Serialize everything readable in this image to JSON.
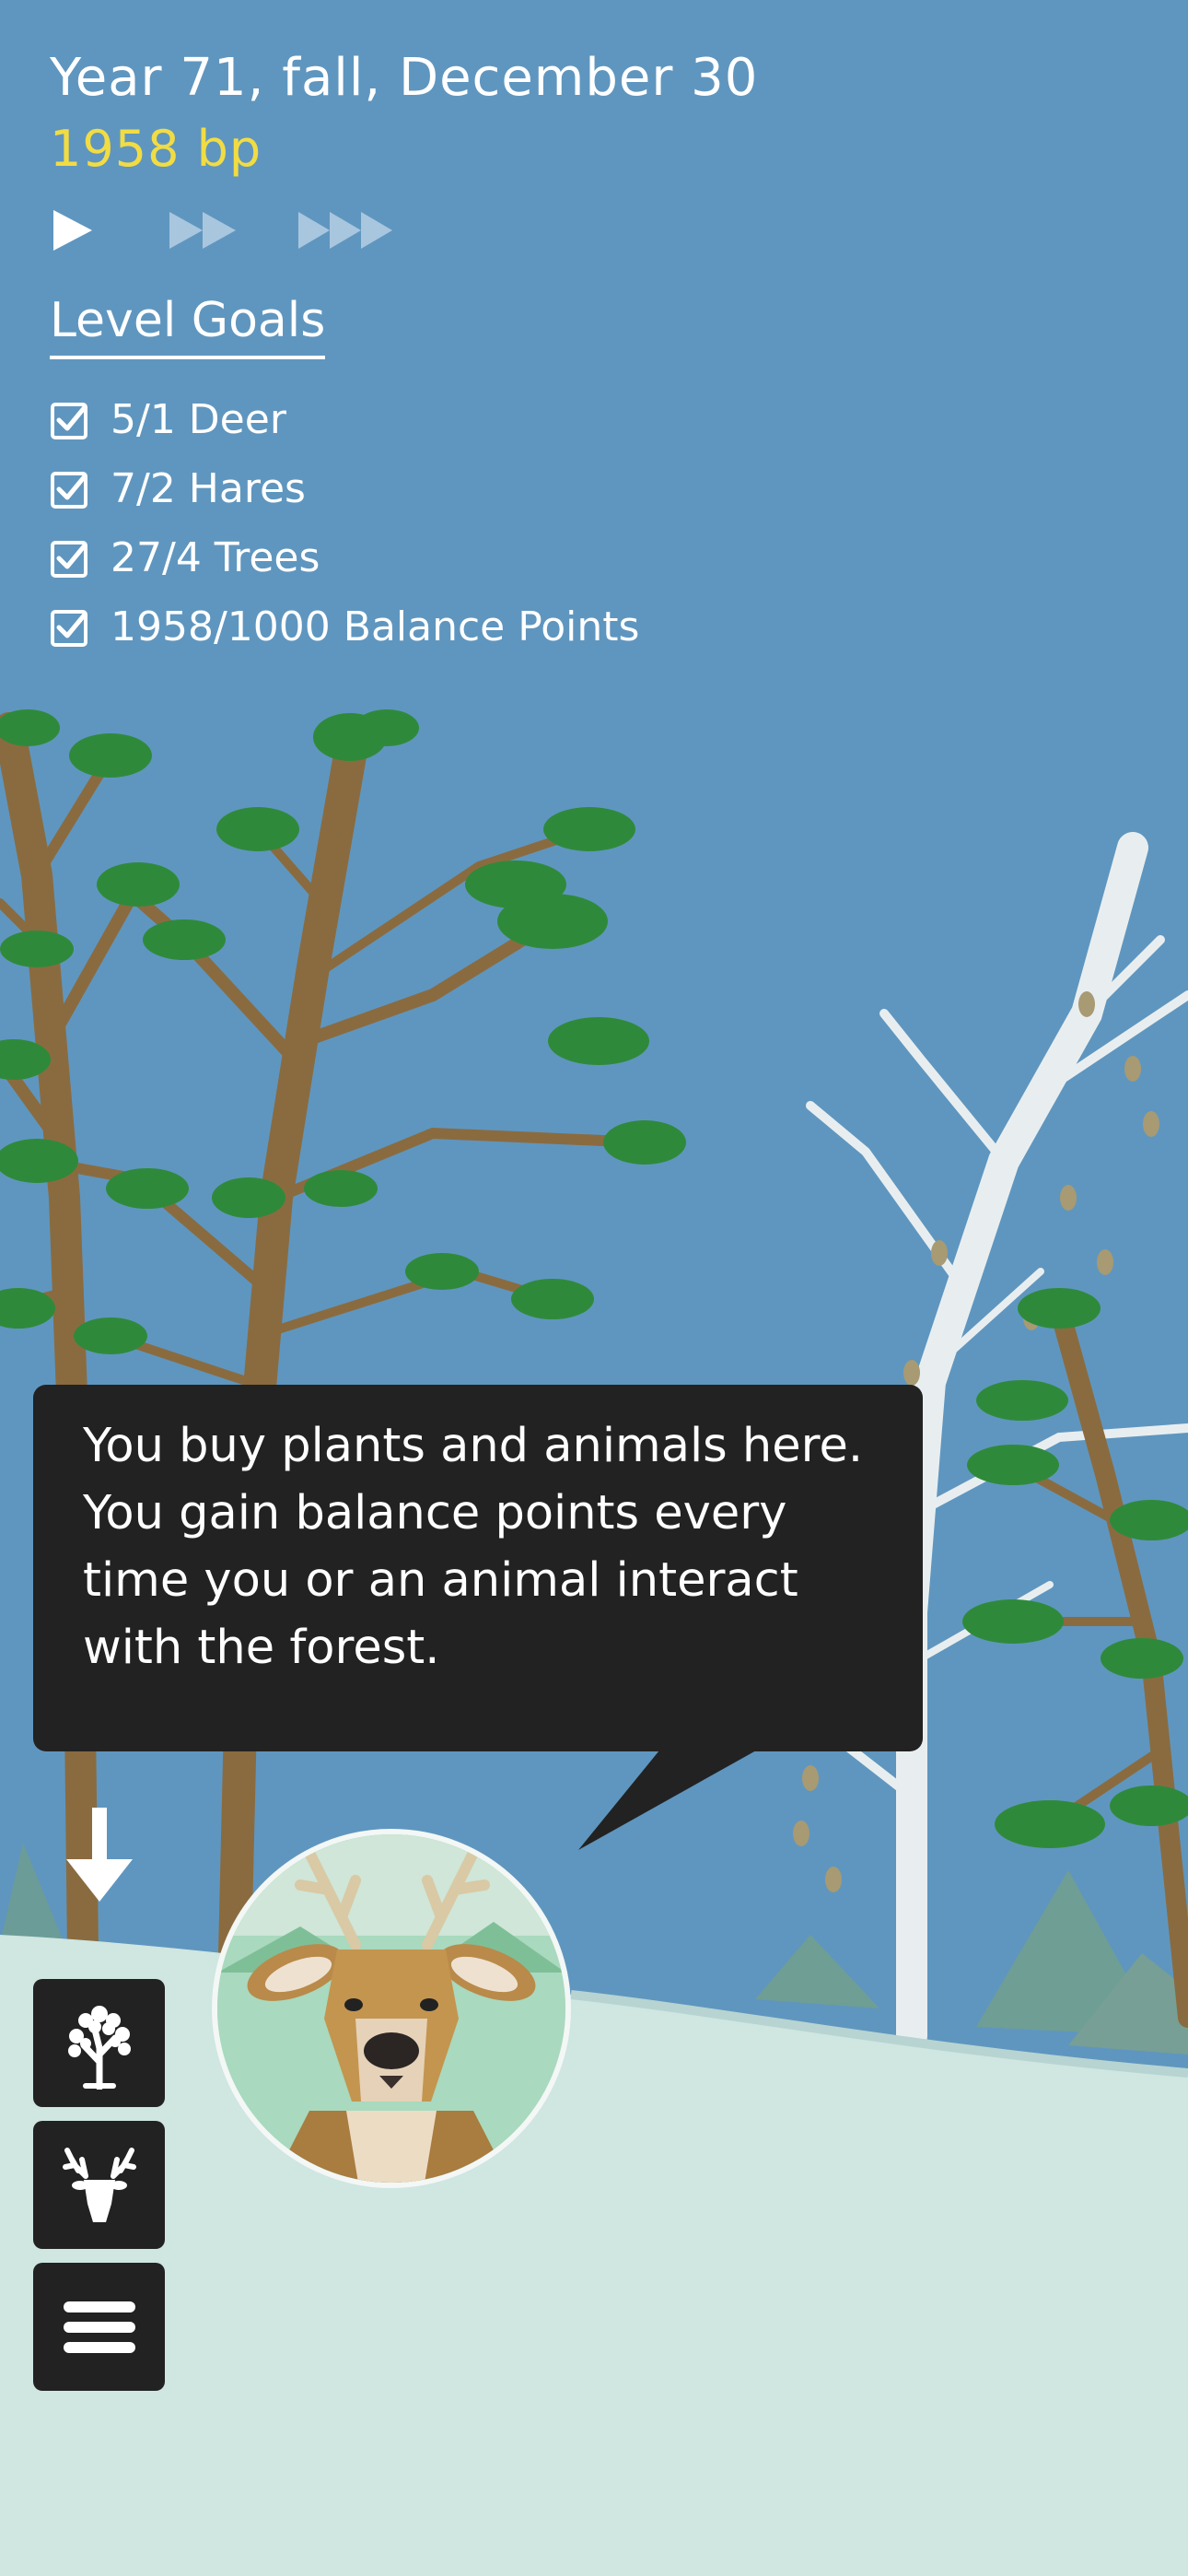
{
  "hud": {
    "date": "Year 71, fall, December 30",
    "balance_points": "1958 bp",
    "speed_controls": [
      {
        "name": "play",
        "active": true
      },
      {
        "name": "fast-forward",
        "active": false
      },
      {
        "name": "fastest-forward",
        "active": false
      }
    ]
  },
  "goals": {
    "title": "Level Goals",
    "items": [
      {
        "label": "5/1 Deer",
        "checked": true
      },
      {
        "label": "7/2 Hares",
        "checked": true
      },
      {
        "label": "27/4 Trees",
        "checked": true
      },
      {
        "label": "1958/1000 Balance Points",
        "checked": true
      }
    ]
  },
  "tooltip": {
    "lines": [
      "You buy plants and animals here.",
      "You gain balance points every",
      "time you or an animal interact",
      "with the forest."
    ]
  },
  "toolbar": {
    "buttons": [
      {
        "icon": "tree-icon"
      },
      {
        "icon": "deer-antlers-icon"
      },
      {
        "icon": "menu-icon"
      }
    ],
    "pointer_icon": "down-arrow-icon"
  },
  "colors": {
    "sky": "#5f96bf",
    "ground": "#cfe6e1",
    "accent_yellow": "#f2dc43",
    "panel": "#222222",
    "pine_trunk": "#8a6b3f",
    "pine_needles": "#2e8a3a",
    "birch": "#e8eef0",
    "inactive_control": "#a9c6df"
  }
}
